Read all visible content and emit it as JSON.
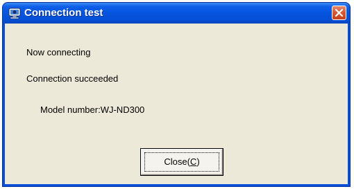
{
  "window": {
    "title": "Connection test",
    "title_icon": "camera-icon",
    "close_icon": "close-icon",
    "accent_color": "#0a4fd8",
    "close_color": "#d65a33",
    "client_bg": "#ece9d8"
  },
  "messages": {
    "status_connecting": "Now connecting",
    "status_result": "Connection succeeded",
    "model_info": "Model number:WJ-ND300"
  },
  "buttons": {
    "close_label_prefix": "Close(",
    "close_label_mnemonic": "C",
    "close_label_suffix": ")"
  }
}
